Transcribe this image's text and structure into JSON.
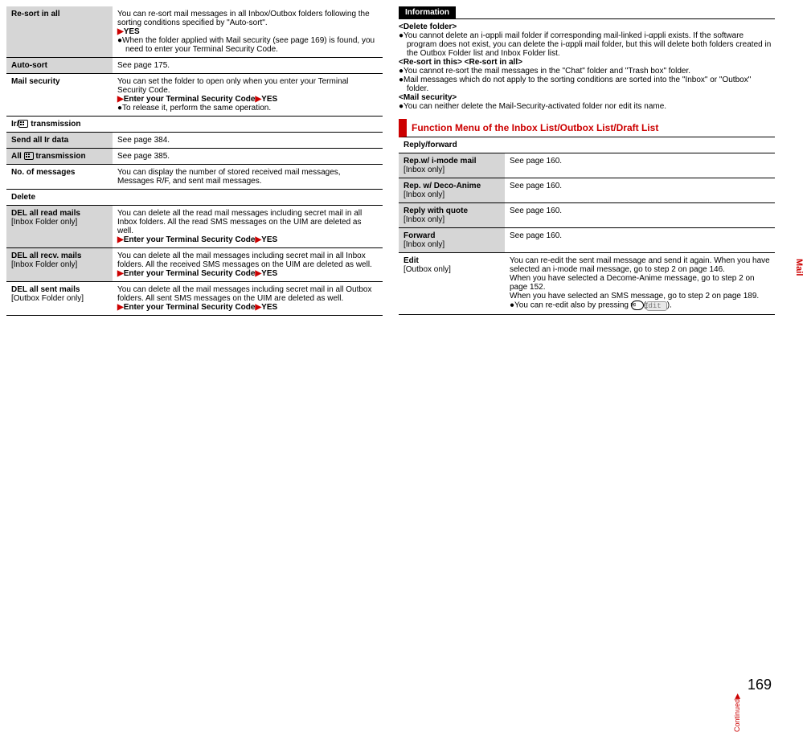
{
  "page_number": "169",
  "side_tab": "Mail",
  "continued_label": "Continued▶",
  "left": {
    "rows": [
      {
        "term": "Re-sort in all",
        "shade": true,
        "body": "You can re-sort mail messages in all Inbox/Outbox folders following the sorting conditions specified by \"Auto-sort\".",
        "after_arrow": "YES",
        "bullet": "When the folder applied with Mail security (see page 169) is found, you need to enter your Terminal Security Code."
      },
      {
        "term": "Auto-sort",
        "shade": true,
        "body": "See page 175."
      },
      {
        "term": "Mail security",
        "body": "You can set the folder to open only when you enter your Terminal Security Code.",
        "after_arrow": "Enter your Terminal Security Code▶YES",
        "bullet": "To release it, perform the same operation."
      },
      {
        "section": "Ir/ transmission",
        "icon": "ir"
      },
      {
        "term": "Send all Ir data",
        "shade": true,
        "body": "See page 384."
      },
      {
        "term": "All  transmission",
        "shade": true,
        "icon": "ir",
        "body": "See page 385."
      },
      {
        "term": "No. of messages",
        "body": "You can display the number of stored received mail messages, Messages R/F, and sent mail messages."
      },
      {
        "section": "Delete"
      },
      {
        "term": "DEL all read mails",
        "sub": "[Inbox Folder only]",
        "shade": true,
        "body": "You can delete all the read mail messages including secret mail in all Inbox folders. All the read SMS messages on the UIM are deleted as well.",
        "after_arrow": "Enter your Terminal Security Code▶YES"
      },
      {
        "term": "DEL all recv. mails",
        "sub": "[Inbox Folder only]",
        "shade": true,
        "body": "You can delete all the mail messages including secret mail in all Inbox folders. All the received SMS messages on the UIM are deleted as well.",
        "after_arrow": "Enter your Terminal Security Code▶YES"
      },
      {
        "term": "DEL all sent mails",
        "sub": "[Outbox Folder only]",
        "body": "You can delete all the mail messages including secret mail in all Outbox folders. All sent SMS messages on the UIM are deleted as well.",
        "after_arrow": "Enter your Terminal Security Code▶YES"
      }
    ]
  },
  "info": {
    "label": "Information",
    "blocks": [
      {
        "tag": "<Delete folder>",
        "lines": [
          "You cannot delete an i-αppli mail folder if corresponding mail-linked i-αppli exists. If the software program does not exist, you can delete the i-αppli mail folder, but this will delete both folders created in the Outbox Folder list and Inbox Folder list."
        ]
      },
      {
        "tag": "<Re-sort in this> <Re-sort in all>",
        "lines": [
          "You cannot re-sort the mail messages in the \"Chat\" folder and \"Trash box\" folder.",
          "Mail messages which do not apply to the sorting conditions are sorted into the \"Inbox\" or \"Outbox\" folder."
        ]
      },
      {
        "tag": "<Mail security>",
        "lines": [
          "You can neither delete the Mail-Security-activated folder nor edit its name."
        ]
      }
    ]
  },
  "fn_title": "Function Menu of the Inbox List/Outbox List/Draft List",
  "right": {
    "rows": [
      {
        "section": "Reply/forward"
      },
      {
        "term": "Rep.w/ i-mode mail",
        "sub": "[Inbox only]",
        "shade": true,
        "body": "See page 160."
      },
      {
        "term": "Rep. w/ Deco-Anime",
        "sub": "[Inbox only]",
        "shade": true,
        "body": "See page 160."
      },
      {
        "term": "Reply with quote",
        "sub": "[Inbox only]",
        "shade": true,
        "body": "See page 160."
      },
      {
        "term": "Forward",
        "sub": "[Inbox only]",
        "shade": true,
        "body": "See page 160."
      },
      {
        "term": "Edit",
        "sub": "[Outbox only]",
        "body": "You can re-edit the sent mail message and send it again. When you have selected an i-mode mail message, go to step 2 on page 146.\nWhen you have selected a Decome-Anime message, go to step 2 on page 152.\nWhen you have selected an SMS message, go to step 2 on page 189.",
        "bullet_html": "You can re-edit also by pressing "
      }
    ],
    "edit_soft_label": "Edit"
  }
}
